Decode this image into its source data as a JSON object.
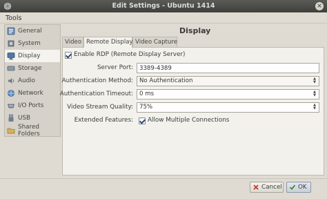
{
  "window": {
    "title": "Edit Settings - Ubuntu 1414",
    "close_glyph": "×",
    "icon": "virtualbox-icon"
  },
  "menu": {
    "tools_label": "Tools"
  },
  "sidebar": {
    "items": [
      {
        "label": "General",
        "icon": "general-icon"
      },
      {
        "label": "System",
        "icon": "system-icon"
      },
      {
        "label": "Display",
        "icon": "display-icon",
        "active": true
      },
      {
        "label": "Storage",
        "icon": "storage-icon"
      },
      {
        "label": "Audio",
        "icon": "audio-icon"
      },
      {
        "label": "Network",
        "icon": "network-icon"
      },
      {
        "label": "I/O Ports",
        "icon": "io-ports-icon"
      },
      {
        "label": "USB",
        "icon": "usb-icon"
      },
      {
        "label": "Shared Folders",
        "icon": "shared-folders-icon"
      }
    ]
  },
  "main": {
    "title": "Display",
    "tabs": [
      {
        "label": "Video"
      },
      {
        "label": "Remote Display",
        "active": true
      },
      {
        "label": "Video Capture"
      }
    ],
    "enable_rdp": {
      "label": "Enable RDP (Remote Display Server)",
      "checked": true
    },
    "server_port": {
      "label": "Server Port:",
      "value": "3389-4389"
    },
    "auth_method": {
      "label": "Authentication Method:",
      "value": "No Authentication"
    },
    "auth_timeout": {
      "label": "Authentication Timeout:",
      "value": "0 ms"
    },
    "video_quality": {
      "label": "Video Stream Quality:",
      "value": "75%"
    },
    "extended": {
      "label": "Extended Features:",
      "allow_multiple": {
        "label": "Allow Multiple Connections",
        "checked": true
      }
    }
  },
  "footer": {
    "cancel_label": "Cancel",
    "ok_label": "OK"
  },
  "colors": {
    "titlebar": "#45453f",
    "background": "#dfdbd2",
    "panel": "#f2f1ec",
    "check": "#2e4a78"
  }
}
